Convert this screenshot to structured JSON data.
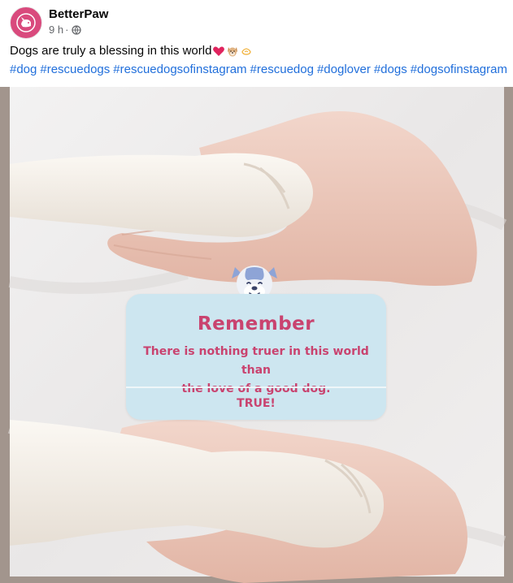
{
  "post": {
    "author": "BetterPaw",
    "time": "9 h",
    "separator": "·",
    "privacy_icon": "globe-icon",
    "caption": "Dogs are truly a blessing in this world",
    "caption_emojis": [
      "red-heart",
      "dog-face",
      "folded-hands"
    ],
    "hashtags": [
      "#dog",
      "#rescuedogs",
      "#rescuedogsofinstagram",
      "#rescuedog",
      "#doglover",
      "#dogs",
      "#dogsofinstagram"
    ]
  },
  "image": {
    "card": {
      "title": "Remember",
      "body_line1": "There is nothing truer in this world than",
      "body_line2": "the love of a good dog.",
      "button": "TRUE!"
    }
  },
  "colors": {
    "accent": "#c9436f",
    "avatar_bg": "#d94a7d",
    "hashtag": "#216fdb",
    "card_bg": "#cde6f0",
    "frame": "#a2958d"
  }
}
